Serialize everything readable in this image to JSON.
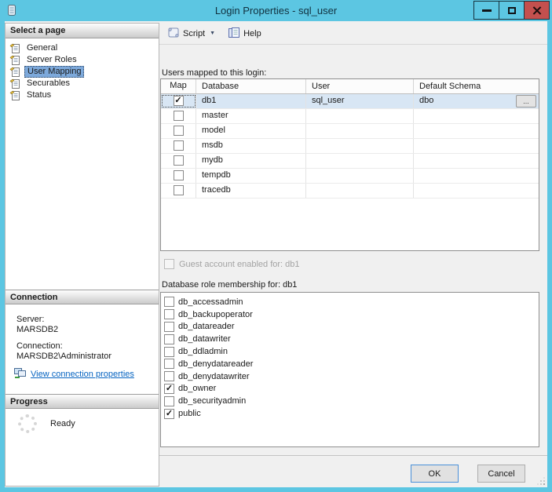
{
  "window": {
    "title": "Login Properties - sql_user"
  },
  "sidebar": {
    "select_page_header": "Select a page",
    "pages": [
      {
        "label": "General",
        "selected": false
      },
      {
        "label": "Server Roles",
        "selected": false
      },
      {
        "label": "User Mapping",
        "selected": true
      },
      {
        "label": "Securables",
        "selected": false
      },
      {
        "label": "Status",
        "selected": false
      }
    ],
    "connection_header": "Connection",
    "server_label": "Server:",
    "server_value": "MARSDB2",
    "connection_label": "Connection:",
    "connection_value": "MARSDB2\\Administrator",
    "view_connection_link": "View connection properties",
    "progress_header": "Progress",
    "progress_status": "Ready"
  },
  "toolbar": {
    "script_label": "Script",
    "help_label": "Help"
  },
  "main": {
    "users_mapped_label": "Users mapped to this login:",
    "table": {
      "columns": [
        "Map",
        "Database",
        "User",
        "Default Schema"
      ],
      "ellipsis_label": "...",
      "rows": [
        {
          "checked": true,
          "database": "db1",
          "user": "sql_user",
          "default_schema": "dbo",
          "selected": true,
          "has_ellipsis": true
        },
        {
          "checked": false,
          "database": "master",
          "user": "",
          "default_schema": "",
          "selected": false,
          "has_ellipsis": false
        },
        {
          "checked": false,
          "database": "model",
          "user": "",
          "default_schema": "",
          "selected": false,
          "has_ellipsis": false
        },
        {
          "checked": false,
          "database": "msdb",
          "user": "",
          "default_schema": "",
          "selected": false,
          "has_ellipsis": false
        },
        {
          "checked": false,
          "database": "mydb",
          "user": "",
          "default_schema": "",
          "selected": false,
          "has_ellipsis": false
        },
        {
          "checked": false,
          "database": "tempdb",
          "user": "",
          "default_schema": "",
          "selected": false,
          "has_ellipsis": false
        },
        {
          "checked": false,
          "database": "tracedb",
          "user": "",
          "default_schema": "",
          "selected": false,
          "has_ellipsis": false
        }
      ]
    },
    "guest_checkbox_label": "Guest account enabled for: db1",
    "guest_checkbox_checked": false,
    "role_membership_label": "Database role membership for: db1",
    "roles": [
      {
        "name": "db_accessadmin",
        "checked": false
      },
      {
        "name": "db_backupoperator",
        "checked": false
      },
      {
        "name": "db_datareader",
        "checked": false
      },
      {
        "name": "db_datawriter",
        "checked": false
      },
      {
        "name": "db_ddladmin",
        "checked": false
      },
      {
        "name": "db_denydatareader",
        "checked": false
      },
      {
        "name": "db_denydatawriter",
        "checked": false
      },
      {
        "name": "db_owner",
        "checked": true
      },
      {
        "name": "db_securityadmin",
        "checked": false
      },
      {
        "name": "public",
        "checked": true
      }
    ]
  },
  "footer": {
    "ok_label": "OK",
    "cancel_label": "Cancel"
  },
  "icons": {
    "check_glyph": "✓",
    "dropdown_arrow": "▼"
  },
  "colors": {
    "titlebar_bg": "#5cc6e2",
    "close_btn_bg": "#c4504e",
    "selection_bg": "#7da9db",
    "row_selection_bg": "#d8e6f4",
    "link_color": "#0563c1"
  }
}
